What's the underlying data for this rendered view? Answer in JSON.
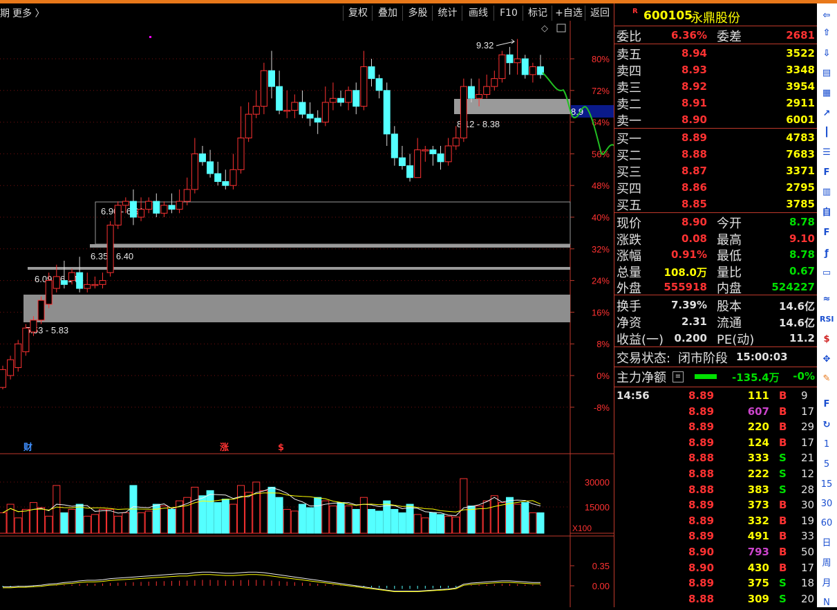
{
  "toolbar": {
    "left_fragment": "期",
    "more_label": "更多 〉",
    "buttons": [
      "复权",
      "叠加",
      "多股",
      "统计",
      "画线",
      "F10",
      "标记",
      "+自选",
      "返回"
    ]
  },
  "chart": {
    "price_scale": [
      "80%",
      "72%",
      "64%",
      "56%",
      "48%",
      "40%",
      "32%",
      "24%",
      "16%",
      "8%",
      "0%",
      "-8%"
    ],
    "volume_scale": [
      "30000",
      "15000"
    ],
    "volume_unit": "X100",
    "macd_scale": [
      "0.35",
      "0.00"
    ],
    "high_marker": "9.32",
    "current_price_tag": "8.9",
    "event_markers": [
      "财",
      "涨",
      "$"
    ],
    "zones": [
      {
        "label": "8.12 - 8.38"
      },
      {
        "label": "6.90 - 6.91"
      },
      {
        "label": "6.35 - 6.40"
      },
      {
        "label": "6.09 - 6.14"
      },
      {
        "label": "5.53 - 5.83"
      }
    ]
  },
  "chart_data": {
    "type": "candlestick",
    "ylim_pct": [
      -12,
      86
    ],
    "candles": [
      [
        -3,
        1.5,
        -3.5,
        2.5
      ],
      [
        0,
        4,
        -1,
        5
      ],
      [
        2,
        8,
        1,
        9
      ],
      [
        6,
        12,
        5,
        13
      ],
      [
        11,
        14,
        10,
        15
      ],
      [
        14,
        19,
        13,
        20
      ],
      [
        18,
        24,
        17,
        26
      ],
      [
        22,
        25,
        21,
        28
      ],
      [
        24,
        23,
        22,
        29
      ],
      [
        24,
        26,
        23,
        27
      ],
      [
        26,
        22,
        21,
        30
      ],
      [
        22,
        23,
        21,
        26
      ],
      [
        23,
        23,
        22,
        25
      ],
      [
        23,
        24,
        22,
        26
      ],
      [
        26,
        38,
        25,
        39
      ],
      [
        38,
        43,
        37,
        44
      ],
      [
        43,
        44,
        41,
        45
      ],
      [
        44,
        40,
        38,
        47
      ],
      [
        40,
        42,
        39,
        45
      ],
      [
        42,
        44,
        41,
        45
      ],
      [
        44,
        41,
        40,
        46
      ],
      [
        41,
        43,
        40,
        44
      ],
      [
        43,
        42,
        41,
        46
      ],
      [
        42,
        44,
        41,
        47
      ],
      [
        44,
        47,
        43,
        50
      ],
      [
        47,
        56,
        46,
        60
      ],
      [
        56,
        54,
        53,
        58
      ],
      [
        54,
        51,
        50,
        57
      ],
      [
        51,
        49,
        48,
        54
      ],
      [
        49,
        48,
        47,
        52
      ],
      [
        48,
        52,
        47,
        56
      ],
      [
        52,
        60,
        51,
        68
      ],
      [
        60,
        66,
        59,
        69
      ],
      [
        66,
        68,
        65,
        72
      ],
      [
        68,
        77,
        66,
        79
      ],
      [
        77,
        73,
        70,
        82
      ],
      [
        73,
        67,
        66,
        77
      ],
      [
        67,
        67,
        65,
        72
      ],
      [
        67,
        69,
        65,
        71
      ],
      [
        69,
        66,
        65,
        72
      ],
      [
        66,
        65,
        63,
        69
      ],
      [
        65,
        64,
        61,
        67
      ],
      [
        64,
        69,
        63,
        73
      ],
      [
        69,
        70,
        67,
        74
      ],
      [
        70,
        69,
        68,
        72
      ],
      [
        69,
        72,
        67,
        73
      ],
      [
        72,
        68,
        66,
        74
      ],
      [
        68,
        78,
        67,
        82
      ],
      [
        78,
        75,
        73,
        80
      ],
      [
        75,
        72,
        70,
        76
      ],
      [
        72,
        61,
        58,
        74
      ],
      [
        61,
        55,
        53,
        63
      ],
      [
        55,
        53,
        52,
        58
      ],
      [
        53,
        50,
        49,
        56
      ],
      [
        50,
        57,
        50,
        60
      ],
      [
        57,
        57,
        54,
        58
      ],
      [
        57,
        56,
        53,
        58
      ],
      [
        56,
        54,
        52,
        58
      ],
      [
        54,
        58,
        53,
        60
      ],
      [
        58,
        60,
        57,
        63
      ],
      [
        60,
        73,
        59,
        75
      ],
      [
        73,
        70,
        69,
        75
      ],
      [
        70,
        71,
        68,
        75
      ],
      [
        71,
        73,
        70,
        76
      ],
      [
        73,
        75,
        72,
        77
      ],
      [
        75,
        81,
        74,
        82
      ],
      [
        81,
        79,
        76,
        83
      ],
      [
        79,
        80,
        76,
        85
      ],
      [
        80,
        76,
        75,
        81
      ],
      [
        76,
        78,
        74,
        79
      ],
      [
        78,
        76,
        75,
        81
      ]
    ],
    "volumes": [
      12000,
      17000,
      9000,
      14000,
      18000,
      15000,
      10000,
      28000,
      12000,
      14000,
      17000,
      10000,
      11000,
      14000,
      14000,
      10000,
      12000,
      28000,
      12000,
      13000,
      17000,
      16000,
      14000,
      19000,
      21000,
      27000,
      22000,
      25000,
      18000,
      20000,
      17000,
      28000,
      24000,
      30000,
      25000,
      27000,
      21000,
      14000,
      13000,
      17000,
      15000,
      21000,
      19000,
      16000,
      18000,
      16000,
      14000,
      21000,
      14000,
      13000,
      19000,
      14000,
      12000,
      17000,
      11000,
      9000,
      12000,
      11000,
      10000,
      9500,
      32000,
      16000,
      16000,
      19000,
      22000,
      18000,
      21000,
      17000,
      18000,
      12000,
      12000
    ],
    "macd_hist": [
      -0.04,
      -0.04,
      -0.03,
      -0.03,
      -0.02,
      -0.01,
      0.01,
      0.02,
      0.04,
      0.05,
      0.07,
      0.08,
      0.08,
      0.09,
      0.11,
      0.12,
      0.13,
      0.14,
      0.15,
      0.16,
      0.17,
      0.18,
      0.19,
      0.2,
      0.2,
      0.22,
      0.23,
      0.23,
      0.22,
      0.21,
      0.21,
      0.22,
      0.23,
      0.23,
      0.22,
      0.2,
      0.18,
      0.16,
      0.14,
      0.12,
      0.1,
      0.08,
      0.06,
      0.04,
      0.02,
      0.0,
      -0.02,
      -0.04,
      -0.06,
      -0.08,
      -0.1,
      -0.12,
      -0.12,
      -0.12,
      -0.12,
      -0.11,
      -0.1,
      -0.09,
      -0.08,
      -0.06,
      0.01,
      0.03,
      0.04,
      0.05,
      0.06,
      0.07,
      0.07,
      0.06,
      0.05,
      0.04,
      0.04
    ]
  },
  "quote": {
    "code": "600105",
    "name": "永鼎股份",
    "r_badge": "R",
    "ratio": {
      "label": "委比",
      "value": "6.36%",
      "label2": "委差",
      "value2": "2681"
    },
    "asks": [
      {
        "label": "卖五",
        "price": "8.94",
        "vol": "3522"
      },
      {
        "label": "卖四",
        "price": "8.93",
        "vol": "3348"
      },
      {
        "label": "卖三",
        "price": "8.92",
        "vol": "3954"
      },
      {
        "label": "卖二",
        "price": "8.91",
        "vol": "2911"
      },
      {
        "label": "卖一",
        "price": "8.90",
        "vol": "6001"
      }
    ],
    "bids": [
      {
        "label": "买一",
        "price": "8.89",
        "vol": "4783"
      },
      {
        "label": "买二",
        "price": "8.88",
        "vol": "7683"
      },
      {
        "label": "买三",
        "price": "8.87",
        "vol": "3371"
      },
      {
        "label": "买四",
        "price": "8.86",
        "vol": "2795"
      },
      {
        "label": "买五",
        "price": "8.85",
        "vol": "3785"
      }
    ],
    "stats": [
      {
        "label": "现价",
        "value": "8.90",
        "label2": "今开",
        "value2": "8.78"
      },
      {
        "label": "涨跌",
        "value": "0.08",
        "label2": "最高",
        "value2": "9.10"
      },
      {
        "label": "涨幅",
        "value": "0.91%",
        "label2": "最低",
        "value2": "8.78"
      },
      {
        "label": "总量",
        "value": "108.0万",
        "label2": "量比",
        "value2": "0.67"
      },
      {
        "label": "外盘",
        "value": "555918",
        "label2": "内盘",
        "value2": "524227"
      }
    ],
    "fund": [
      {
        "label": "换手",
        "value": "7.39%",
        "label2": "股本",
        "value2": "14.6亿"
      },
      {
        "label": "净资",
        "value": "2.31",
        "label2": "流通",
        "value2": "14.6亿"
      },
      {
        "label": "收益(一)",
        "value": "0.200",
        "label2": "PE(动)",
        "value2": "11.2"
      }
    ],
    "trade_status": {
      "label": "交易状态:",
      "value": "闭市阶段",
      "time": "15:00:03"
    },
    "main_force": {
      "label": "主力净额",
      "value": "-135.4万",
      "pct": "-0%"
    },
    "ticks": [
      {
        "time": "14:56",
        "price": "8.89",
        "vol": "111",
        "side": "B",
        "n": "9"
      },
      {
        "time": "",
        "price": "8.89",
        "vol": "607",
        "side": "B",
        "n": "17"
      },
      {
        "time": "",
        "price": "8.89",
        "vol": "220",
        "side": "B",
        "n": "29"
      },
      {
        "time": "",
        "price": "8.89",
        "vol": "124",
        "side": "B",
        "n": "17"
      },
      {
        "time": "",
        "price": "8.88",
        "vol": "333",
        "side": "S",
        "n": "21"
      },
      {
        "time": "",
        "price": "8.88",
        "vol": "222",
        "side": "S",
        "n": "12"
      },
      {
        "time": "",
        "price": "8.88",
        "vol": "383",
        "side": "S",
        "n": "28"
      },
      {
        "time": "",
        "price": "8.89",
        "vol": "373",
        "side": "B",
        "n": "30"
      },
      {
        "time": "",
        "price": "8.89",
        "vol": "332",
        "side": "B",
        "n": "19"
      },
      {
        "time": "",
        "price": "8.89",
        "vol": "491",
        "side": "B",
        "n": "33"
      },
      {
        "time": "",
        "price": "8.90",
        "vol": "793",
        "side": "B",
        "n": "50"
      },
      {
        "time": "",
        "price": "8.90",
        "vol": "430",
        "side": "B",
        "n": "17"
      },
      {
        "time": "",
        "price": "8.89",
        "vol": "375",
        "side": "S",
        "n": "18"
      },
      {
        "time": "",
        "price": "8.88",
        "vol": "309",
        "side": "S",
        "n": "20"
      }
    ]
  },
  "sidebar": {
    "icons": [
      "arrow-left-icon",
      "arrow-up-icon",
      "arrow-down-icon",
      "doc-icon",
      "grid-icon",
      "line-chart-icon",
      "kline-icon",
      "table-icon",
      "f10-icon",
      "book-icon",
      "self-icon",
      "f12-icon",
      "fx-icon",
      "tv-icon",
      "wave-icon",
      "rsi-icon",
      "dollar-icon",
      "move-icon",
      "pen-icon",
      "f5-icon",
      "refresh-icon"
    ],
    "labels": [
      "RSI",
      "1",
      "5",
      "15",
      "30",
      "60",
      "日",
      "周",
      "月",
      "N"
    ]
  },
  "colors": {
    "up": "#ff3232",
    "down": "#54ffff",
    "accent": "#e8781a",
    "grid": "#c0392b",
    "yellow": "#ffff00",
    "green": "#00e000"
  }
}
